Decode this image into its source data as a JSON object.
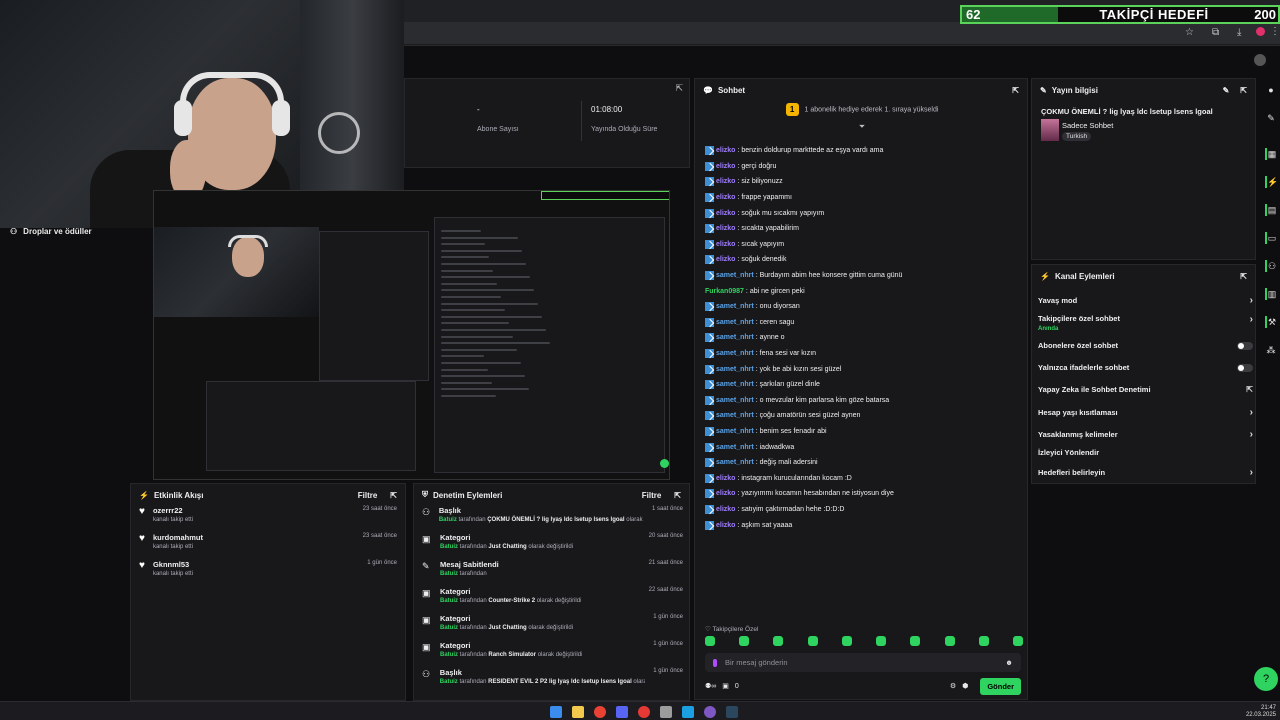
{
  "goal": {
    "current": "62",
    "title": "TAKİPÇİ HEDEFİ",
    "target": "200"
  },
  "webcam": {
    "overlay_label": "Droplar ve ödüller"
  },
  "stats": {
    "subs_value": "-",
    "subs_label": "Abone Sayısı",
    "live_value": "01:08:00",
    "live_label": "Yayında Olduğu Süre"
  },
  "activity": {
    "title": "Etkinlik Akışı",
    "filter": "Filtre",
    "items": [
      {
        "name": "ozerrr22",
        "sub": "kanalı takip etti",
        "time": "23 saat önce"
      },
      {
        "name": "kurdomahmut",
        "sub": "kanalı takip etti",
        "time": "23 saat önce"
      },
      {
        "name": "Gknnml53",
        "sub": "kanalı takip etti",
        "time": "1 gün önce"
      }
    ]
  },
  "mod": {
    "title": "Denetim Eylemleri",
    "filter": "Filtre",
    "items": [
      {
        "title": "Başlık",
        "who": "Batuiz",
        "pre": " tarafından ",
        "hl": "ÇOKMU ÖNEMLİ ? lig lyaş ldc lsetup lsens lgoal",
        "post": " olarak değiştirildi",
        "time": "1 saat önce"
      },
      {
        "title": "Kategori",
        "who": "Batuiz",
        "pre": " tarafından ",
        "hl": "Just Chatting",
        "post": " olarak değiştirildi",
        "time": "20 saat önce"
      },
      {
        "title": "Mesaj Sabitlendi",
        "who": "Batuiz",
        "pre": " tarafından",
        "hl": "",
        "post": "",
        "time": "21 saat önce"
      },
      {
        "title": "Kategori",
        "who": "Batuiz",
        "pre": " tarafından ",
        "hl": "Counter-Strike 2",
        "post": " olarak değiştirildi",
        "time": "22 saat önce"
      },
      {
        "title": "Kategori",
        "who": "Batuiz",
        "pre": " tarafından ",
        "hl": "Just Chatting",
        "post": " olarak değiştirildi",
        "time": "1 gün önce"
      },
      {
        "title": "Kategori",
        "who": "Batuiz",
        "pre": " tarafından ",
        "hl": "Ranch Simulator",
        "post": " olarak değiştirildi",
        "time": "1 gün önce"
      },
      {
        "title": "Başlık",
        "who": "Batuiz",
        "pre": " tarafından ",
        "hl": "RESIDENT EVIL 2 P2 lig lyaş ldc lsetup lsens lgoal",
        "post": " olarak",
        "time": "1 gün önce"
      }
    ]
  },
  "chat": {
    "title": "Sohbet",
    "pinned": "1 abonelik hediye ederek 1. sıraya yükseldi",
    "pinned_rank": "1",
    "messages": [
      {
        "user": "elizko",
        "color": "#9f7dff",
        "badge": true,
        "text": "benzin doldurup markttede az eşya vardı ama"
      },
      {
        "user": "elizko",
        "color": "#9f7dff",
        "badge": true,
        "text": "gerçi doğru"
      },
      {
        "user": "elizko",
        "color": "#9f7dff",
        "badge": true,
        "text": "siz biliyonuzz"
      },
      {
        "user": "elizko",
        "color": "#9f7dff",
        "badge": true,
        "text": "frappe yapammı"
      },
      {
        "user": "elizko",
        "color": "#9f7dff",
        "badge": true,
        "text": "soğuk mu sıcakmı yapıyım"
      },
      {
        "user": "elizko",
        "color": "#9f7dff",
        "badge": true,
        "text": "sıcakta yapabilirim"
      },
      {
        "user": "elizko",
        "color": "#9f7dff",
        "badge": true,
        "text": "sıcak yapıyım"
      },
      {
        "user": "elizko",
        "color": "#9f7dff",
        "badge": true,
        "text": "soğuk denedik"
      },
      {
        "user": "samet_nhrt",
        "color": "#5aa3e8",
        "badge": true,
        "text": "Burdayım abim hee konsere gittim cuma günü"
      },
      {
        "user": "Furkan0987",
        "color": "#2fd35f",
        "badge": false,
        "text": "abi ne gircen peki"
      },
      {
        "user": "samet_nhrt",
        "color": "#5aa3e8",
        "badge": true,
        "text": "onu diyorsan"
      },
      {
        "user": "samet_nhrt",
        "color": "#5aa3e8",
        "badge": true,
        "text": "ceren sagu"
      },
      {
        "user": "samet_nhrt",
        "color": "#5aa3e8",
        "badge": true,
        "text": "aynne o"
      },
      {
        "user": "samet_nhrt",
        "color": "#5aa3e8",
        "badge": true,
        "text": "fena sesi var kızın"
      },
      {
        "user": "samet_nhrt",
        "color": "#5aa3e8",
        "badge": true,
        "text": "yok be abi kızın sesi güzel"
      },
      {
        "user": "samet_nhrt",
        "color": "#5aa3e8",
        "badge": true,
        "text": "şarkıları güzel dinle"
      },
      {
        "user": "samet_nhrt",
        "color": "#5aa3e8",
        "badge": true,
        "text": "o mevzular kim parlarsa kim göze batarsa"
      },
      {
        "user": "samet_nhrt",
        "color": "#5aa3e8",
        "badge": true,
        "text": "çoğu amatörün sesi güzel aynen"
      },
      {
        "user": "samet_nhrt",
        "color": "#5aa3e8",
        "badge": true,
        "text": "benim ses fenadır abi"
      },
      {
        "user": "samet_nhrt",
        "color": "#5aa3e8",
        "badge": true,
        "text": "iadwadkwa"
      },
      {
        "user": "samet_nhrt",
        "color": "#5aa3e8",
        "badge": true,
        "text": "değiş mali adersini"
      },
      {
        "user": "elizko",
        "color": "#9f7dff",
        "badge": true,
        "text": "instagram kurucularından kocam :D"
      },
      {
        "user": "elizko",
        "color": "#9f7dff",
        "badge": true,
        "text": "yazıyımmı kocamın hesabından ne istiyosun diye"
      },
      {
        "user": "elizko",
        "color": "#9f7dff",
        "badge": true,
        "text": "satıyim çaktırmadan hehe :D:D:D"
      },
      {
        "user": "elizko",
        "color": "#9f7dff",
        "badge": true,
        "text": "aşkım sat yaaaa"
      }
    ],
    "followers_only": "Takipçilere Özel",
    "input_placeholder": "Bir mesaj gönderin",
    "points": "0",
    "send": "Gönder"
  },
  "stream_info": {
    "title": "Yayın bilgisi",
    "stream_title": "ÇOKMU ÖNEMLİ ? lig lyaş ldc lsetup lsens lgoal",
    "category": "Sadece Sohbet",
    "tag": "Turkish"
  },
  "channel": {
    "title": "Kanal Eylemleri",
    "slow": "Yavaş mod",
    "followers": "Takipçilere özel sohbet",
    "followers_state": "Anında",
    "subs": "Abonelere özel sohbet",
    "emotes": "Yalnızca ifadelerle sohbet",
    "ai": "Yapay Zeka ile Sohbet Denetimi",
    "age": "Hesap yaşı kısıtlaması",
    "banned": "Yasaklanmış kelimeler",
    "raid": "İzleyici Yönlendir",
    "goals": "Hedefleri belirleyin"
  },
  "clock": {
    "time": "21:47",
    "date": "22.03.2025"
  },
  "colors": {
    "accent": "#2fd35f",
    "panel": "#18181b",
    "bg": "#0e0e10"
  }
}
